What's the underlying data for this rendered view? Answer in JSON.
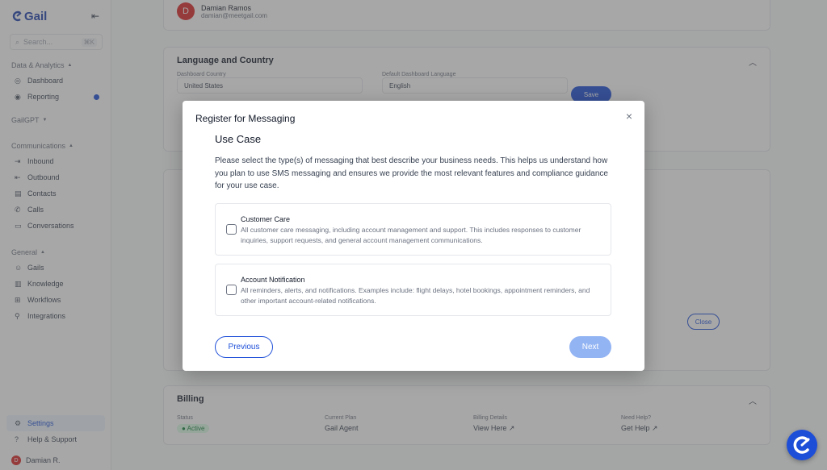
{
  "sidebar": {
    "logo": "Gail",
    "search_placeholder": "Search...",
    "search_shortcut": "⌘K",
    "sections": [
      {
        "label": "Data & Analytics",
        "items": [
          "Dashboard",
          "Reporting"
        ]
      },
      {
        "label": "GailGPT",
        "items": []
      },
      {
        "label": "Communications",
        "items": [
          "Inbound",
          "Outbound",
          "Contacts",
          "Calls",
          "Conversations"
        ]
      },
      {
        "label": "General",
        "items": [
          "Gails",
          "Knowledge",
          "Workflows",
          "Integrations"
        ]
      }
    ],
    "settings": "Settings",
    "help": "Help & Support",
    "user": "Damian R."
  },
  "profile": {
    "initial": "D",
    "name": "Damian Ramos",
    "email": "damian@meetgail.com"
  },
  "language": {
    "title": "Language and Country",
    "country_label": "Dashboard Country",
    "country_value": "United States",
    "lang_label": "Default Dashboard Language",
    "lang_value": "English",
    "save": "Save"
  },
  "background": {
    "close": "Close"
  },
  "billing": {
    "title": "Billing",
    "status_label": "Status",
    "status_value": "Active",
    "plan_label": "Current Plan",
    "plan_value": "Gail Agent",
    "details_label": "Billing Details",
    "details_value": "View Here",
    "help_label": "Need Help?",
    "help_value": "Get Help"
  },
  "modal": {
    "title": "Register for Messaging",
    "step_title": "Use Case",
    "description": "Please select the type(s) of messaging that best describe your business needs. This helps us understand how you plan to use SMS messaging and ensures we provide the most relevant features and compliance guidance for your use case.",
    "options": [
      {
        "title": "Customer Care",
        "description": "All customer care messaging, including account management and support. This includes responses to customer inquiries, support requests, and general account management communications."
      },
      {
        "title": "Account Notification",
        "description": "All reminders, alerts, and notifications. Examples include: flight delays, hotel bookings, appointment reminders, and other important account-related notifications."
      }
    ],
    "previous": "Previous",
    "next": "Next"
  },
  "colors": {
    "brand": "#1d4ed8",
    "next_disabled": "#93b4f3",
    "overlay": "rgba(80,80,80,0.5)"
  }
}
